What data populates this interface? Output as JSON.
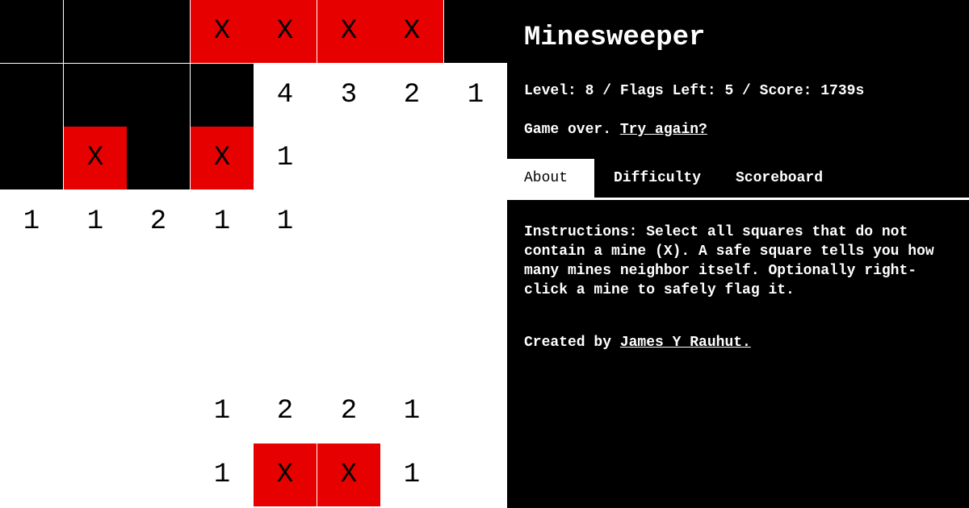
{
  "colors": {
    "hidden": "#000000",
    "mine": "#e60000",
    "revealed": "#ffffff",
    "panel": "#000000"
  },
  "board": {
    "rows": [
      [
        {
          "state": "hidden",
          "label": ""
        },
        {
          "state": "hidden",
          "label": ""
        },
        {
          "state": "hidden",
          "label": ""
        },
        {
          "state": "mine",
          "label": "X"
        },
        {
          "state": "mine",
          "label": "X"
        },
        {
          "state": "mine",
          "label": "X"
        },
        {
          "state": "mine",
          "label": "X"
        },
        {
          "state": "hidden",
          "label": ""
        }
      ],
      [
        {
          "state": "hidden",
          "label": ""
        },
        {
          "state": "hidden",
          "label": ""
        },
        {
          "state": "hidden",
          "label": ""
        },
        {
          "state": "hidden",
          "label": ""
        },
        {
          "state": "revealed",
          "label": "4"
        },
        {
          "state": "revealed",
          "label": "3"
        },
        {
          "state": "revealed",
          "label": "2"
        },
        {
          "state": "revealed",
          "label": "1"
        }
      ],
      [
        {
          "state": "hidden",
          "label": ""
        },
        {
          "state": "mine",
          "label": "X"
        },
        {
          "state": "hidden",
          "label": ""
        },
        {
          "state": "mine",
          "label": "X"
        },
        {
          "state": "revealed",
          "label": "1"
        },
        {
          "state": "revealed",
          "label": ""
        },
        {
          "state": "revealed",
          "label": ""
        },
        {
          "state": "revealed",
          "label": ""
        }
      ],
      [
        {
          "state": "revealed",
          "label": "1"
        },
        {
          "state": "revealed",
          "label": "1"
        },
        {
          "state": "revealed",
          "label": "2"
        },
        {
          "state": "revealed",
          "label": "1"
        },
        {
          "state": "revealed",
          "label": "1"
        },
        {
          "state": "revealed",
          "label": ""
        },
        {
          "state": "revealed",
          "label": ""
        },
        {
          "state": "revealed",
          "label": ""
        }
      ],
      [
        {
          "state": "revealed",
          "label": ""
        },
        {
          "state": "revealed",
          "label": ""
        },
        {
          "state": "revealed",
          "label": ""
        },
        {
          "state": "revealed",
          "label": ""
        },
        {
          "state": "revealed",
          "label": ""
        },
        {
          "state": "revealed",
          "label": ""
        },
        {
          "state": "revealed",
          "label": ""
        },
        {
          "state": "revealed",
          "label": ""
        }
      ],
      [
        {
          "state": "revealed",
          "label": ""
        },
        {
          "state": "revealed",
          "label": ""
        },
        {
          "state": "revealed",
          "label": ""
        },
        {
          "state": "revealed",
          "label": ""
        },
        {
          "state": "revealed",
          "label": ""
        },
        {
          "state": "revealed",
          "label": ""
        },
        {
          "state": "revealed",
          "label": ""
        },
        {
          "state": "revealed",
          "label": ""
        }
      ],
      [
        {
          "state": "revealed",
          "label": ""
        },
        {
          "state": "revealed",
          "label": ""
        },
        {
          "state": "revealed",
          "label": ""
        },
        {
          "state": "revealed",
          "label": "1"
        },
        {
          "state": "revealed",
          "label": "2"
        },
        {
          "state": "revealed",
          "label": "2"
        },
        {
          "state": "revealed",
          "label": "1"
        },
        {
          "state": "revealed",
          "label": ""
        }
      ],
      [
        {
          "state": "revealed",
          "label": ""
        },
        {
          "state": "revealed",
          "label": ""
        },
        {
          "state": "revealed",
          "label": ""
        },
        {
          "state": "revealed",
          "label": "1"
        },
        {
          "state": "mine",
          "label": "X"
        },
        {
          "state": "mine",
          "label": "X"
        },
        {
          "state": "revealed",
          "label": "1"
        },
        {
          "state": "revealed",
          "label": ""
        }
      ]
    ]
  },
  "panel": {
    "title": "Minesweeper",
    "stats": "Level: 8 / Flags Left: 5 / Score: 1739s",
    "status_text": "Game over. ",
    "retry_link": "Try again?",
    "tabs": [
      {
        "label": "About",
        "active": true
      },
      {
        "label": "Difficulty",
        "active": false
      },
      {
        "label": "Scoreboard",
        "active": false
      }
    ],
    "instructions": "Instructions: Select all squares that do not contain a mine (X). A safe square tells you how many mines neighbor itself. Optionally right-click a mine to safely flag it.",
    "credit_prefix": "Created by ",
    "credit_link": "James Y Rauhut."
  }
}
